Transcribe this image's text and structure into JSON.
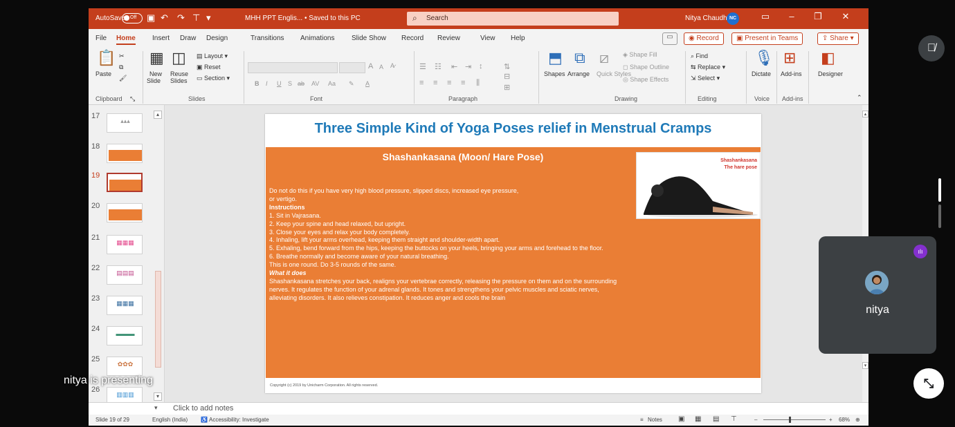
{
  "titlebar": {
    "autosave_label": "AutoSave",
    "autosave_state": "Off",
    "doc_title": "MHH PPT Englis...  •  Saved to this PC",
    "search_placeholder": "Search",
    "user_name": "Nitya Chaudhary",
    "user_initials": "NC"
  },
  "tabs": [
    "File",
    "Home",
    "Insert",
    "Draw",
    "Design",
    "Transitions",
    "Animations",
    "Slide Show",
    "Record",
    "Review",
    "View",
    "Help"
  ],
  "tab_active": "Home",
  "tab_right": {
    "record": "Record",
    "present_teams": "Present in Teams",
    "share": "Share"
  },
  "ribbon": {
    "clipboard": {
      "paste": "Paste",
      "label": "Clipboard"
    },
    "slides": {
      "new_slide": "New",
      "new_slide_2": "Slide",
      "reuse": "Reuse",
      "reuse_2": "Slides",
      "layout": "Layout",
      "reset": "Reset",
      "section": "Section",
      "label": "Slides"
    },
    "font": {
      "label": "Font"
    },
    "paragraph": {
      "label": "Paragraph"
    },
    "drawing": {
      "shapes": "Shapes",
      "arrange": "Arrange",
      "quick_styles": "Quick Styles",
      "shape_fill": "Shape Fill",
      "shape_outline": "Shape Outline",
      "shape_effects": "Shape Effects",
      "label": "Drawing"
    },
    "editing": {
      "find": "Find",
      "replace": "Replace",
      "select": "Select",
      "label": "Editing"
    },
    "voice": {
      "dictate": "Dictate",
      "label": "Voice"
    },
    "addins": {
      "addins": "Add-ins",
      "label": "Add-ins"
    },
    "designer": {
      "designer": "Designer"
    }
  },
  "thumbnails": [
    {
      "num": "17"
    },
    {
      "num": "18"
    },
    {
      "num": "19"
    },
    {
      "num": "20"
    },
    {
      "num": "21"
    },
    {
      "num": "22"
    },
    {
      "num": "23"
    },
    {
      "num": "24"
    },
    {
      "num": "25"
    },
    {
      "num": "26"
    }
  ],
  "selected_slide": "19",
  "slide": {
    "title": "Three Simple Kind of Yoga Poses relief in Menstrual Cramps",
    "pose_name": "Shashankasana (Moon/ Hare Pose)",
    "photo_caption_1": "Shashankasana",
    "photo_caption_2": "The hare pose",
    "lines": [
      {
        "text": "Do not do this if you have very high blood pressure, slipped discs, increased eye pressure,",
        "style": "normal"
      },
      {
        "text": " or vertigo.",
        "style": "normal"
      },
      {
        "text": "Instructions",
        "style": "bold"
      },
      {
        "text": "1. Sit in Vajrasana.",
        "style": "normal"
      },
      {
        "text": "2. Keep your spine and head relaxed, but upright.",
        "style": "normal"
      },
      {
        "text": "3. Close your eyes and relax your body completely.",
        "style": "normal"
      },
      {
        "text": "4. Inhaling, lift your arms overhead, keeping them straight and shoulder-width apart.",
        "style": "normal"
      },
      {
        "text": "5. Exhaling, bend forward from the hips, keeping the buttocks on your heels, bringing your arms and forehead to the floor.",
        "style": "normal"
      },
      {
        "text": "6. Breathe normally and become aware of your natural breathing.",
        "style": "normal"
      },
      {
        "text": "This is one round. Do 3-5 rounds of the same.",
        "style": "normal"
      },
      {
        "text": "What it does",
        "style": "bi"
      },
      {
        "text": "Shashankasana stretches your back, realigns your vertebrae correctly, releasing the pressure on them and on the surrounding",
        "style": "normal"
      },
      {
        "text": "nerves. It regulates the function of your adrenal glands. It tones and strengthens your pelvic muscles and sciatic nerves,",
        "style": "normal"
      },
      {
        "text": "alleviating disorders. It also relieves constipation. It reduces anger and cools the brain",
        "style": "normal"
      }
    ],
    "copyright": "Copyright (c) 2019 by Unicharm Corporation. All rights reserved."
  },
  "notes_placeholder": "Click to add notes",
  "statusbar": {
    "slide_info": "Slide 19 of 29",
    "language": "English (India)",
    "accessibility": "Accessibility: Investigate",
    "notes": "Notes",
    "zoom": "68%"
  },
  "meet": {
    "presenting_text": "nitya is presenting",
    "participant_name": "nitya"
  },
  "colors": {
    "brand": "#c43e1c",
    "slide_box": "#ea7e35",
    "title_blue": "#1f7ab8",
    "speaking": "#8430ce"
  }
}
